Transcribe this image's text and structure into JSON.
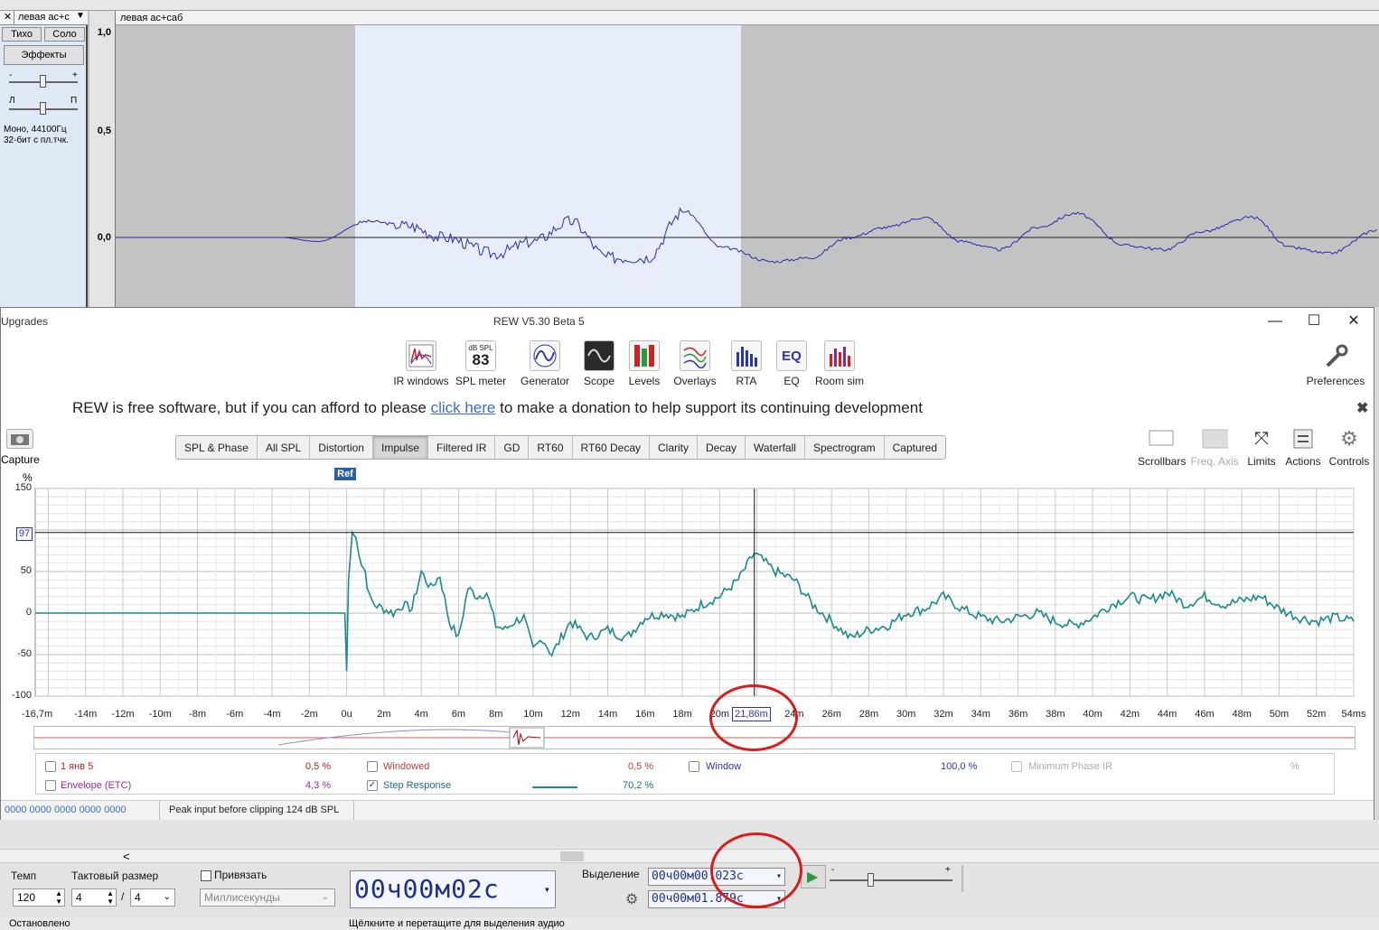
{
  "audacity": {
    "track_name": "левая ас+с",
    "track_title": "левая ас+саб",
    "mute_label": "Тихо",
    "solo_label": "Соло",
    "effects_label": "Эффекты",
    "gain_minus": "-",
    "gain_plus": "+",
    "pan_left": "Л",
    "pan_right": "П",
    "info_line1": "Моно, 44100Гц",
    "info_line2": "32-бит с пл.тчк.",
    "close_glyph": "✕",
    "vruler": [
      "1,0",
      "0,5",
      "0,0"
    ],
    "tempo_label": "Темп",
    "tempo_value": "120",
    "timesig_label": "Тактовый размер",
    "timesig_num": "4",
    "timesig_sep": "/",
    "timesig_den": "4",
    "snap_label": "Привязать",
    "snap_unit": "Миллисекунды",
    "time_display": "00ч00м02с",
    "selection_label": "Выделение",
    "sel_start": "00ч00м00.023с",
    "sel_end": "00ч00м01.879с",
    "status_left": "Остановлено",
    "status_right": "Щёлкните и перетащите для выделения аудио",
    "scroll_left_glyph": "<"
  },
  "rew": {
    "title": "REW V5.30 Beta 5",
    "left_title": "Upgrades",
    "toolbar": [
      {
        "label": "IR windows",
        "icon": "ir-windows-icon"
      },
      {
        "label": "SPL meter",
        "icon": "spl-meter-icon",
        "badge_top": "dB SPL",
        "badge_value": "83"
      },
      {
        "label": "Generator",
        "icon": "generator-icon"
      },
      {
        "label": "Scope",
        "icon": "scope-icon"
      },
      {
        "label": "Levels",
        "icon": "levels-icon"
      },
      {
        "label": "Overlays",
        "icon": "overlays-icon"
      },
      {
        "label": "RTA",
        "icon": "rta-icon"
      },
      {
        "label": "EQ",
        "icon": "eq-icon"
      },
      {
        "label": "Room sim",
        "icon": "room-sim-icon"
      }
    ],
    "preferences_label": "Preferences",
    "donate_pre": "REW is free software, but if you can afford to please",
    "donate_link": "click here",
    "donate_post": "to make a donation to help support its continuing development",
    "capture_label": "Capture",
    "tabs": [
      "SPL & Phase",
      "All SPL",
      "Distortion",
      "Impulse",
      "Filtered IR",
      "GD",
      "RT60",
      "RT60 Decay",
      "Clarity",
      "Decay",
      "Waterfall",
      "Spectrogram",
      "Captured"
    ],
    "active_tab": "Impulse",
    "right_tools": [
      "Scrollbars",
      "Freq. Axis",
      "Limits",
      "Actions",
      "Controls"
    ],
    "y_unit": "%",
    "ref_label": "Ref",
    "cursor_y": "97",
    "cursor_x": "21,86m",
    "legend": {
      "m1": {
        "name": "1 янв 5",
        "value": "0,5 %"
      },
      "m2": {
        "name": "Envelope (ETC)",
        "value": "4,3 %"
      },
      "m3": {
        "name": "Windowed",
        "value": "0,5 %"
      },
      "m4": {
        "name": "Step Response",
        "value": "70,2 %"
      },
      "m5": {
        "name": "Window",
        "value": "100,0 %"
      },
      "m6": {
        "name": "Minimum Phase IR",
        "value": "%"
      }
    },
    "status_code": "0000  0000 0000  0000 0000",
    "status_msg": "Peak input before clipping 124 dB SPL",
    "colors": {
      "trace": "#1a8a8a",
      "window_blue": "#2a34b4",
      "wave": "#2a2ab0"
    }
  },
  "chart_data": [
    {
      "type": "line",
      "title": "",
      "xlabel": "",
      "ylabel": "%",
      "x_ticks": [
        "-16,7m",
        "-14m",
        "-12m",
        "-10m",
        "-8m",
        "-6m",
        "-4m",
        "-2m",
        "0u",
        "2m",
        "4m",
        "6m",
        "8m",
        "10m",
        "12m",
        "14m",
        "16m",
        "18m",
        "20m",
        "24m",
        "26m",
        "28m",
        "30m",
        "32m",
        "34m",
        "36m",
        "38m",
        "40m",
        "42m",
        "44m",
        "46m",
        "48m",
        "50m",
        "52m",
        "54ms"
      ],
      "y_ticks": [
        "150",
        "50",
        "0",
        "-50",
        "-100"
      ],
      "xlim": [
        -16.7,
        54
      ],
      "ylim": [
        -100,
        150
      ],
      "grid": true,
      "series": [
        {
          "name": "Step Response",
          "x": [
            -16.7,
            -2,
            -0.1,
            0,
            0.1,
            0.3,
            0.5,
            0.8,
            1.0,
            1.2,
            1.5,
            2,
            2.5,
            3,
            3.5,
            4,
            4.5,
            5,
            5.5,
            6,
            6.5,
            7,
            7.5,
            8,
            8.5,
            9,
            9.5,
            10,
            10.5,
            11,
            12,
            13,
            14,
            15,
            16,
            17,
            18,
            19,
            20,
            21,
            21.86,
            23,
            24,
            25,
            26,
            27,
            28,
            29,
            30,
            31,
            32,
            33,
            34,
            35,
            36,
            37,
            38,
            39,
            40,
            41,
            42,
            43,
            44,
            45,
            46,
            47,
            48,
            49,
            50,
            51,
            52,
            53,
            54
          ],
          "y": [
            0,
            0,
            0,
            -70,
            40,
            97,
            90,
            60,
            50,
            20,
            10,
            5,
            0,
            10,
            5,
            50,
            30,
            45,
            -10,
            -30,
            30,
            20,
            25,
            -15,
            -20,
            -10,
            -5,
            -45,
            -30,
            -50,
            -10,
            -30,
            -20,
            -30,
            -5,
            0,
            -5,
            10,
            20,
            40,
            72,
            50,
            40,
            10,
            -10,
            -30,
            -20,
            -15,
            0,
            5,
            20,
            5,
            -5,
            -10,
            -5,
            0,
            -10,
            -15,
            -5,
            10,
            20,
            15,
            25,
            10,
            20,
            10,
            15,
            20,
            5,
            -5,
            -10,
            -5,
            -10
          ]
        }
      ]
    },
    {
      "type": "line",
      "title": "",
      "xlabel": "",
      "ylabel": "",
      "y_ticks": [
        "1,0",
        "0,5",
        "0,0"
      ],
      "series": [
        {
          "name": "левая ас+саб",
          "x": [
            0,
            0.05,
            0.1,
            0.13,
            0.16,
            0.2,
            0.23,
            0.26,
            0.3,
            0.33,
            0.36,
            0.39,
            0.42,
            0.45,
            0.48,
            0.52,
            0.55,
            0.58,
            0.61,
            0.64,
            0.67,
            0.7,
            0.73,
            0.76,
            0.8,
            0.83,
            0.86,
            0.9,
            0.93,
            0.96,
            1.0
          ],
          "y": [
            0,
            0,
            0,
            0,
            -0.02,
            0.08,
            0.06,
            0.0,
            -0.08,
            -0.02,
            0.08,
            -0.1,
            -0.1,
            0.13,
            -0.05,
            -0.12,
            -0.1,
            0.0,
            0.05,
            0.1,
            -0.02,
            -0.06,
            0.05,
            0.12,
            -0.04,
            -0.06,
            0.03,
            0.1,
            -0.05,
            -0.08,
            0.04
          ]
        }
      ]
    }
  ]
}
